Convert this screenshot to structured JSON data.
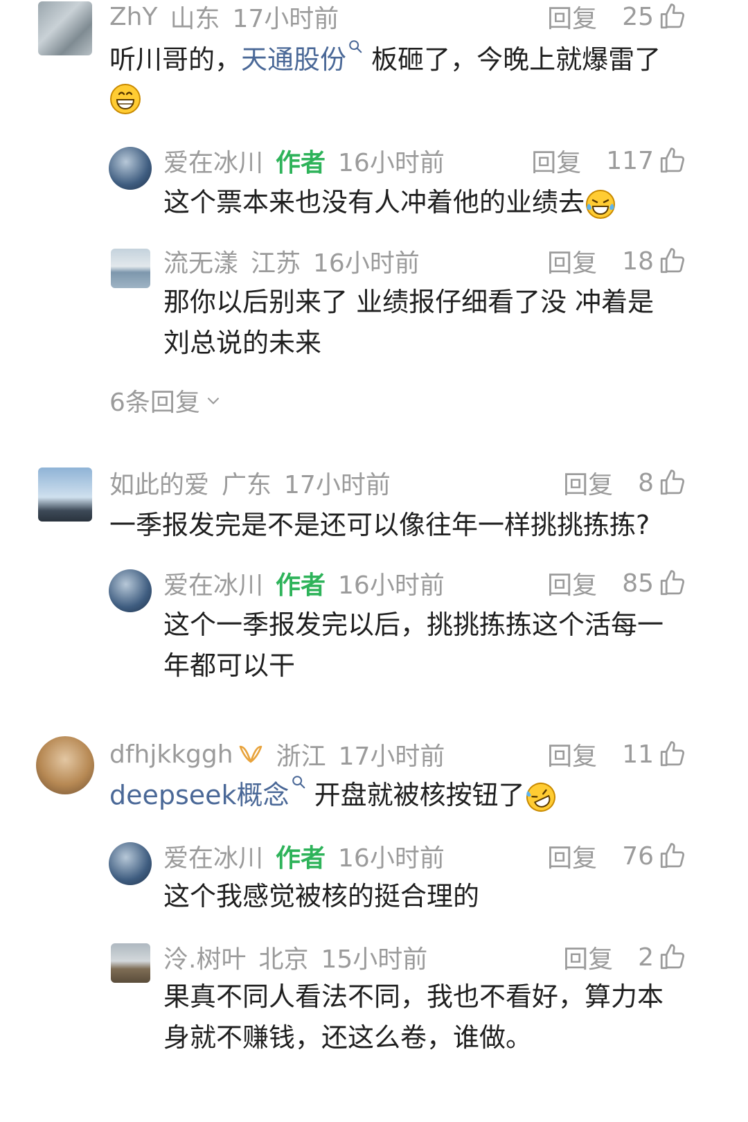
{
  "comments": [
    {
      "user": "ZhY",
      "location": "山东",
      "time": "17小时前",
      "reply_label": "回复",
      "likes": "25",
      "text_pre": "听川哥的，",
      "link": "天通股份",
      "text_post": "板砸了，今晚上就爆雷了",
      "emoji": "grinning-emoji",
      "replies": [
        {
          "user": "爱在冰川",
          "badge": "作者",
          "time": "16小时前",
          "reply_label": "回复",
          "likes": "117",
          "text": "这个票本来也没有人冲着他的业绩去",
          "emoji": "tears-of-joy-emoji"
        },
        {
          "user": "流无漾",
          "location": "江苏",
          "time": "16小时前",
          "reply_label": "回复",
          "likes": "18",
          "line1": "那你以后别来了 业绩报仔细看了没 冲着是",
          "line2": "刘总说的未来"
        }
      ],
      "more_replies": "6条回复"
    },
    {
      "user": "如此的爱",
      "location": "广东",
      "time": "17小时前",
      "reply_label": "回复",
      "likes": "8",
      "text": "一季报发完是不是还可以像往年一样挑挑拣拣?",
      "replies": [
        {
          "user": "爱在冰川",
          "badge": "作者",
          "time": "16小时前",
          "reply_label": "回复",
          "likes": "85",
          "line1": "这个一季报发完以后，挑挑拣拣这个活每一",
          "line2": "年都可以干"
        }
      ]
    },
    {
      "user": "dfhjkkggh",
      "location": "浙江",
      "time": "17小时前",
      "reply_label": "回复",
      "likes": "11",
      "link": "deepseek概念",
      "text_post": "开盘就被核按钮了",
      "emoji": "rolling-laughing-emoji",
      "replies": [
        {
          "user": "爱在冰川",
          "badge": "作者",
          "time": "16小时前",
          "reply_label": "回复",
          "likes": "76",
          "text": "这个我感觉被核的挺合理的"
        },
        {
          "user": "泠.树叶",
          "location": "北京",
          "time": "15小时前",
          "reply_label": "回复",
          "likes": "2",
          "line1": "果真不同人看法不同，我也不看好，算力本",
          "line2": "身就不赚钱，还这么卷，谁做。"
        }
      ]
    }
  ],
  "colors": {
    "author_badge": "#2eb35a",
    "link": "#4a6897",
    "meta": "#9b9b9b",
    "text": "#1f1f1f"
  },
  "icons": [
    "thumb-up-icon",
    "search-lens-icon",
    "chevron-down-icon",
    "vip-badge-icon"
  ]
}
